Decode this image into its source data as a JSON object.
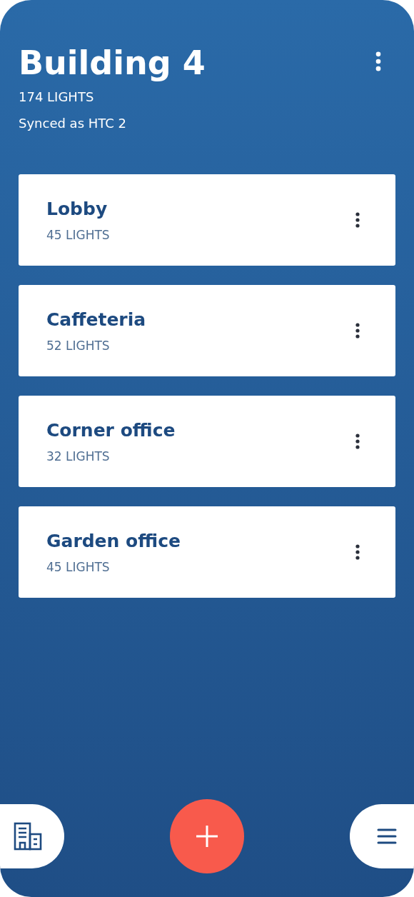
{
  "header": {
    "title": "Building 4",
    "count": "174 LIGHTS",
    "sync_status": "Synced as HTC 2"
  },
  "rooms": [
    {
      "name": "Lobby",
      "count": "45 LIGHTS"
    },
    {
      "name": "Caffeteria",
      "count": "52 LIGHTS"
    },
    {
      "name": "Corner office",
      "count": "32 LIGHTS"
    },
    {
      "name": "Garden office",
      "count": "45 LIGHTS"
    }
  ]
}
